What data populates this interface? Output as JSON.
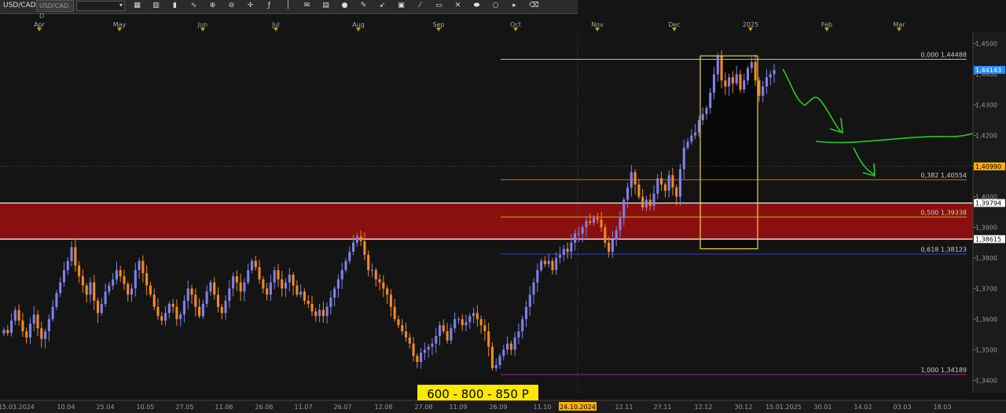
{
  "toolbar": {
    "symbol": "USD/CAD",
    "symbol_field": "USD/CAD, D",
    "icons": [
      "new-chart-icon",
      "bar-chart-icon",
      "candles-icon",
      "line-chart-icon",
      "zoom-in-icon",
      "zoom-out-icon",
      "crosshair-icon",
      "indicator-icon",
      "vertical-line-icon",
      "comment-icon",
      "template-icon",
      "globe-icon",
      "pencil-icon",
      "arrow-icon",
      "save-icon",
      "brush-icon",
      "rectangle-icon",
      "cross-icon",
      "ellipse-icon",
      "circle-icon",
      "more-icon",
      "eraser-icon"
    ]
  },
  "months": [
    "Apr",
    "May",
    "Jun",
    "Jul",
    "Aug",
    "Sep",
    "Oct",
    "Nov",
    "Dec",
    "2025",
    "Feb",
    "Mar"
  ],
  "price_axis": {
    "ticks": [
      "1,4500",
      "1,4400",
      "1,4300",
      "1,4200",
      "1,4100",
      "1,4000",
      "1,3900",
      "1,3800",
      "1,3700",
      "1,3600",
      "1,3500",
      "1,3400"
    ],
    "badges": [
      {
        "price": "1,44143",
        "color": "#2a8cff"
      },
      {
        "price": "1,40990",
        "color": "#ffb000"
      },
      {
        "price": "1,39794",
        "color": "#ffffff"
      },
      {
        "price": "1,38615",
        "color": "#ffffff"
      }
    ]
  },
  "date_axis": [
    "15.03.2024",
    "10.04",
    "25.04",
    "10.05",
    "27.05",
    "11.06",
    "26.06",
    "11.07",
    "26.07",
    "12.08",
    "27.08",
    "11.09",
    "26.09",
    "11.10",
    "24.10.2024",
    "12.11",
    "27.11",
    "12.12",
    "30.12",
    "15.01.2025",
    "30.01",
    "14.02",
    "03.03",
    "18.03"
  ],
  "fibonacci": [
    {
      "label": "0,000 1,44488",
      "color": "#bdbdbd"
    },
    {
      "label": "0,382 1,40554",
      "color": "#c8701a"
    },
    {
      "label": "0,500 1,39338",
      "color": "#c8b400"
    },
    {
      "label": "0,618 1,38123",
      "color": "#3b3bd0"
    },
    {
      "label": "1,000 1,34189",
      "color": "#a020a0"
    }
  ],
  "annotation": {
    "text": "600 - 800 - 850 P"
  },
  "colors": {
    "bull": "#8080e8",
    "bear": "#f08a24",
    "zone": "#8a0f0f",
    "box": "#e6d840",
    "arrow": "#22cc22"
  },
  "chart_data": {
    "type": "candlestick",
    "symbol": "USD/CAD",
    "ylim": [
      1.336,
      1.454
    ],
    "resistance_zone": [
      1.38615,
      1.39794
    ],
    "crosshair_price": 1.4099,
    "crosshair_date": "24.10.2024",
    "closes": [
      1.3565,
      1.3555,
      1.3595,
      1.363,
      1.3595,
      1.356,
      1.354,
      1.3585,
      1.3615,
      1.357,
      1.3535,
      1.356,
      1.36,
      1.364,
      1.3685,
      1.372,
      1.376,
      1.379,
      1.3835,
      1.3775,
      1.374,
      1.371,
      1.368,
      1.372,
      1.366,
      1.362,
      1.365,
      1.369,
      1.371,
      1.373,
      1.376,
      1.374,
      1.3715,
      1.368,
      1.37,
      1.376,
      1.379,
      1.375,
      1.371,
      1.368,
      1.364,
      1.361,
      1.3595,
      1.362,
      1.365,
      1.364,
      1.36,
      1.3615,
      1.366,
      1.37,
      1.368,
      1.364,
      1.361,
      1.365,
      1.369,
      1.372,
      1.368,
      1.364,
      1.362,
      1.366,
      1.37,
      1.374,
      1.372,
      1.369,
      1.372,
      1.376,
      1.379,
      1.377,
      1.373,
      1.37,
      1.368,
      1.372,
      1.376,
      1.373,
      1.37,
      1.372,
      1.3745,
      1.371,
      1.368,
      1.369,
      1.366,
      1.365,
      1.3625,
      1.361,
      1.363,
      1.361,
      1.364,
      1.367,
      1.37,
      1.373,
      1.376,
      1.379,
      1.382,
      1.385,
      1.387,
      1.3855,
      1.381,
      1.376,
      1.376,
      1.373,
      1.372,
      1.37,
      1.368,
      1.364,
      1.36,
      1.358,
      1.356,
      1.354,
      1.352,
      1.348,
      1.346,
      1.349,
      1.35,
      1.351,
      1.352,
      1.3545,
      1.358,
      1.356,
      1.353,
      1.357,
      1.36,
      1.36,
      1.358,
      1.359,
      1.361,
      1.362,
      1.36,
      1.358,
      1.356,
      1.351,
      1.344,
      1.345,
      1.348,
      1.35,
      1.352,
      1.35,
      1.354,
      1.356,
      1.36,
      1.364,
      1.368,
      1.372,
      1.376,
      1.379,
      1.378,
      1.379,
      1.376,
      1.38,
      1.381,
      1.383,
      1.382,
      1.385,
      1.388,
      1.388,
      1.39,
      1.392,
      1.3915,
      1.393,
      1.3925,
      1.39,
      1.385,
      1.382,
      1.386,
      1.389,
      1.393,
      1.399,
      1.403,
      1.408,
      1.404,
      1.4,
      1.3965,
      1.399,
      1.397,
      1.401,
      1.406,
      1.404,
      1.402,
      1.407,
      1.403,
      1.4,
      1.409,
      1.416,
      1.418,
      1.42,
      1.421,
      1.425,
      1.427,
      1.429,
      1.434,
      1.44,
      1.446,
      1.438,
      1.436,
      1.439,
      1.437,
      1.44,
      1.435,
      1.438,
      1.442,
      1.444,
      1.438,
      1.433,
      1.436,
      1.439,
      1.44,
      1.4414
    ]
  }
}
